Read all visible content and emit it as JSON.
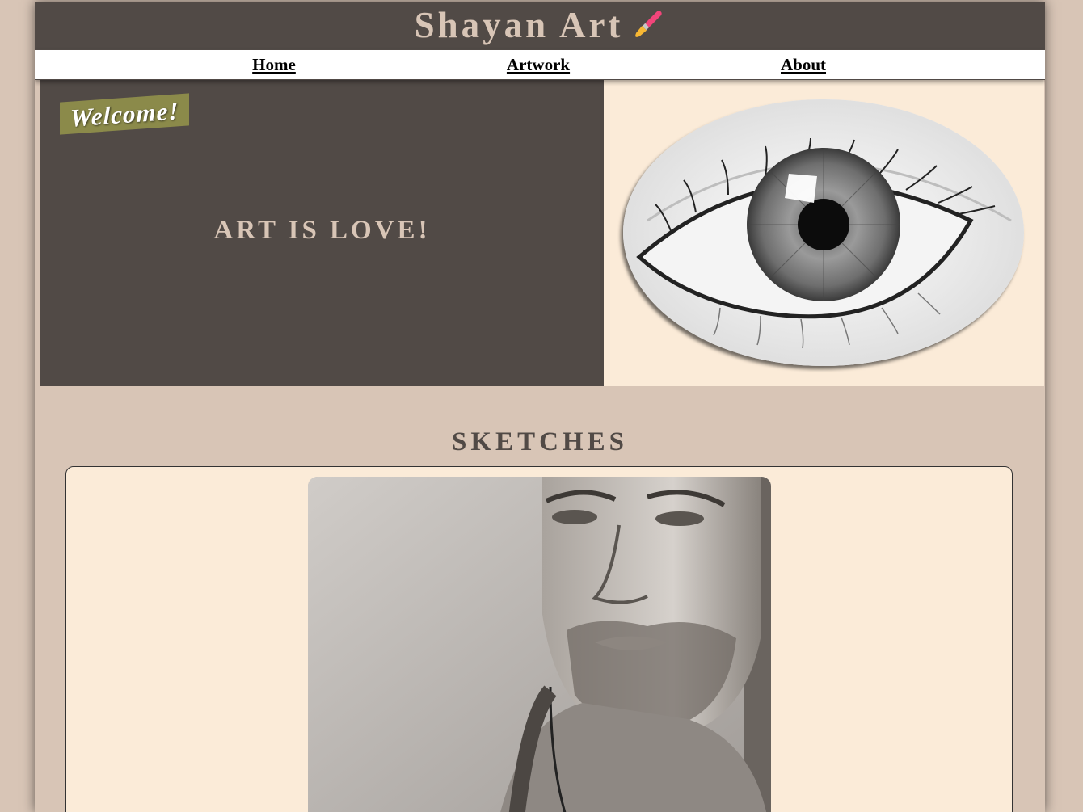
{
  "header": {
    "title": "Shayan Art",
    "brush_icon": "paintbrush-icon"
  },
  "nav": {
    "items": [
      {
        "label": "Home"
      },
      {
        "label": "Artwork"
      },
      {
        "label": "About"
      }
    ]
  },
  "hero": {
    "badge": "Welcome!",
    "tagline": "ART IS LOVE!",
    "image": "eye-sketch-image"
  },
  "sketches": {
    "title": "SKETCHES",
    "items": [
      {
        "image": "portrait-sketch-image"
      }
    ]
  },
  "colors": {
    "header_bg": "#514a46",
    "page_bg": "#d8c5b6",
    "cream": "#fbebd8",
    "badge": "#8b8a4a",
    "brush_pink": "#f2457a",
    "brush_yellow": "#f7b733"
  }
}
